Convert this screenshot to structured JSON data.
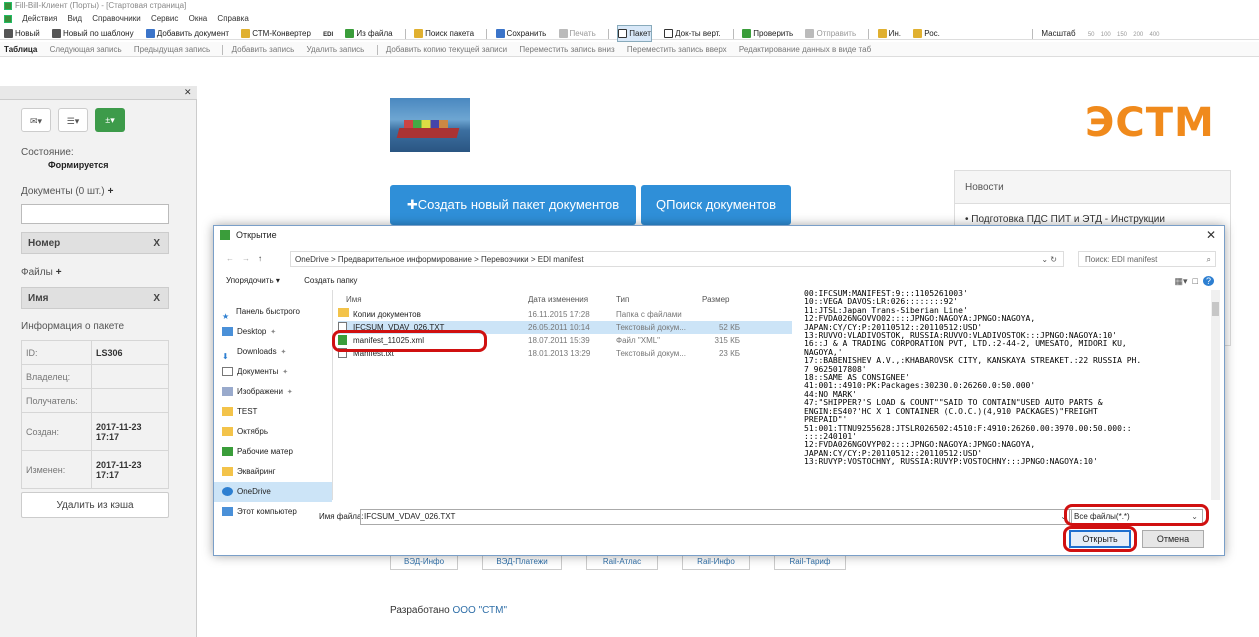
{
  "window": {
    "title": "Fill-Bill-Клиент (Порты) - [Стартовая страница]"
  },
  "menu": [
    "Действия",
    "Вид",
    "Справочники",
    "Сервис",
    "Окна",
    "Справка"
  ],
  "toolbar1": [
    "Новый",
    "Новый по шаблону",
    "Добавить документ",
    "СТМ-Конвертер",
    "EDI",
    "Из файла",
    "Поиск пакета",
    "Сохранить",
    "Печать",
    "Пакет",
    "Док-ты верт.",
    "Проверить",
    "Отправить",
    "Ин.",
    "Рос.",
    "Масштаб",
    "50",
    "100",
    "150",
    "200",
    "400"
  ],
  "toolbar2": [
    "Таблица",
    "Следующая запись",
    "Предыдущая запись",
    "Добавить запись",
    "Удалить запись",
    "Добавить копию текущей записи",
    "Переместить запись вниз",
    "Переместить запись вверх",
    "Редактирование данных в виде таб"
  ],
  "left": {
    "state_label": "Состояние:",
    "state_value": "Формируется",
    "docs_label": "Документы (0 шт.)",
    "col_number": "Номер",
    "col_x": "X",
    "files_label": "Файлы",
    "col_name": "Имя",
    "info_label": "Информация о пакете",
    "info": [
      {
        "k": "ID:",
        "v": "LS306"
      },
      {
        "k": "Владелец:",
        "v": ""
      },
      {
        "k": "Получатель:",
        "v": ""
      },
      {
        "k": "Создан:",
        "v": "2017-11-23 17:17"
      },
      {
        "k": "Изменен:",
        "v": "2017-11-23 17:17"
      }
    ],
    "clear_cache": "Удалить из кэша"
  },
  "main": {
    "logo": "ЭСТМ",
    "create_btn": "Создать новый пакет документов",
    "search_btn": "Поиск документов",
    "news_title": "Новости",
    "news_item": "Подготовка ПДС ПИТ и ЭТД - Инструкции",
    "links": [
      "ВЭД-Инфо",
      "ВЭД-Платежи",
      "Rail-Атлас",
      "Rail-Инфо",
      "Rail-Тариф"
    ],
    "developed": "Разработано",
    "company": "ООО \"СТМ\""
  },
  "dialog": {
    "title": "Открытие",
    "path": "OneDrive  >  Предварительное информирование  >  Перевозчики  >  EDI manifest",
    "search_placeholder": "Поиск: EDI manifest",
    "organize": "Упорядочить ▾",
    "new_folder": "Создать папку",
    "nav": [
      "Панель быстрого",
      "Desktop",
      "Downloads",
      "Документы",
      "Изображени",
      "TEST",
      "Октябрь",
      "Рабочие матер",
      "Эквайринг",
      "OneDrive",
      "Этот компьютер"
    ],
    "cols": {
      "name": "Имя",
      "date": "Дата изменения",
      "type": "Тип",
      "size": "Размер"
    },
    "files": [
      {
        "name": "Копии документов",
        "date": "16.11.2015 17:28",
        "type": "Папка с файлами",
        "size": ""
      },
      {
        "name": "IFCSUM_VDAV_026.TXT",
        "date": "26.05.2011 10:14",
        "type": "Текстовый докум...",
        "size": "52 КБ"
      },
      {
        "name": "manifest_11025.xml",
        "date": "18.07.2011 15:39",
        "type": "Файл \"XML\"",
        "size": "315 КБ"
      },
      {
        "name": "Manifest.txt",
        "date": "18.01.2013 13:29",
        "type": "Текстовый докум...",
        "size": "23 КБ"
      }
    ],
    "preview": "00:IFCSUM:MANIFEST:9:::1105261003'\n10::VEGA DAVOS:LR:026::::::::92'\n11:JTSL:Japan Trans-Siberian Line'\n12:FVDA026NGOVVO02::::JPNGO:NAGOYA:JPNGO:NAGOYA,\nJAPAN:CY/CY:P:20110512::20110512:USD'\n13:RUVVO:VLADIVOSTOK, RUSSIA:RUVVO:VLADIVOSTOK:::JPNGO:NAGOYA:10'\n16::J & A TRADING CORPORATION PVT, LTD.:2-44-2, UMESATO, MIDORI KU,\nNAGOYA,'\n17::BABENISHEV A.V.,:KHABAROVSK CITY, KANSKAYA STREAKET.:22 RUSSIA PH.\n7 9625017808'\n18::SAME AS CONSIGNEE'\n41:001::4910:PK:Packages:30230.0:26260.0:50.000'\n44:NO MARK'\n47:\"SHIPPER?'S LOAD & COUNT\"\"SAID TO CONTAIN\"USED AUTO PARTS &\nENGIN:ES40?'HC X 1 CONTAINER (C.O.C.)(4,910 PACKAGES)\"FREIGHT\nPREPAID\"'\n51:001:TTNU9255628:JTSLR026502:4510:F:4910:26260.00:3970.00:50.000::\n::::240101'\n12:FVDA026NGOVYP02::::JPNGO:NAGOYA:JPNGO:NAGOYA,\nJAPAN:CY/CY:P:20110512::20110512:USD'\n13:RUVYP:VOSTOCHNY, RUSSIA:RUVYP:VOSTOCHNY:::JPNGO:NAGOYA:10'",
    "filename_label": "Имя файла:",
    "filename_value": "IFCSUM_VDAV_026.TXT",
    "filetype": "Все файлы(*.*)",
    "open": "Открыть",
    "cancel": "Отмена"
  }
}
